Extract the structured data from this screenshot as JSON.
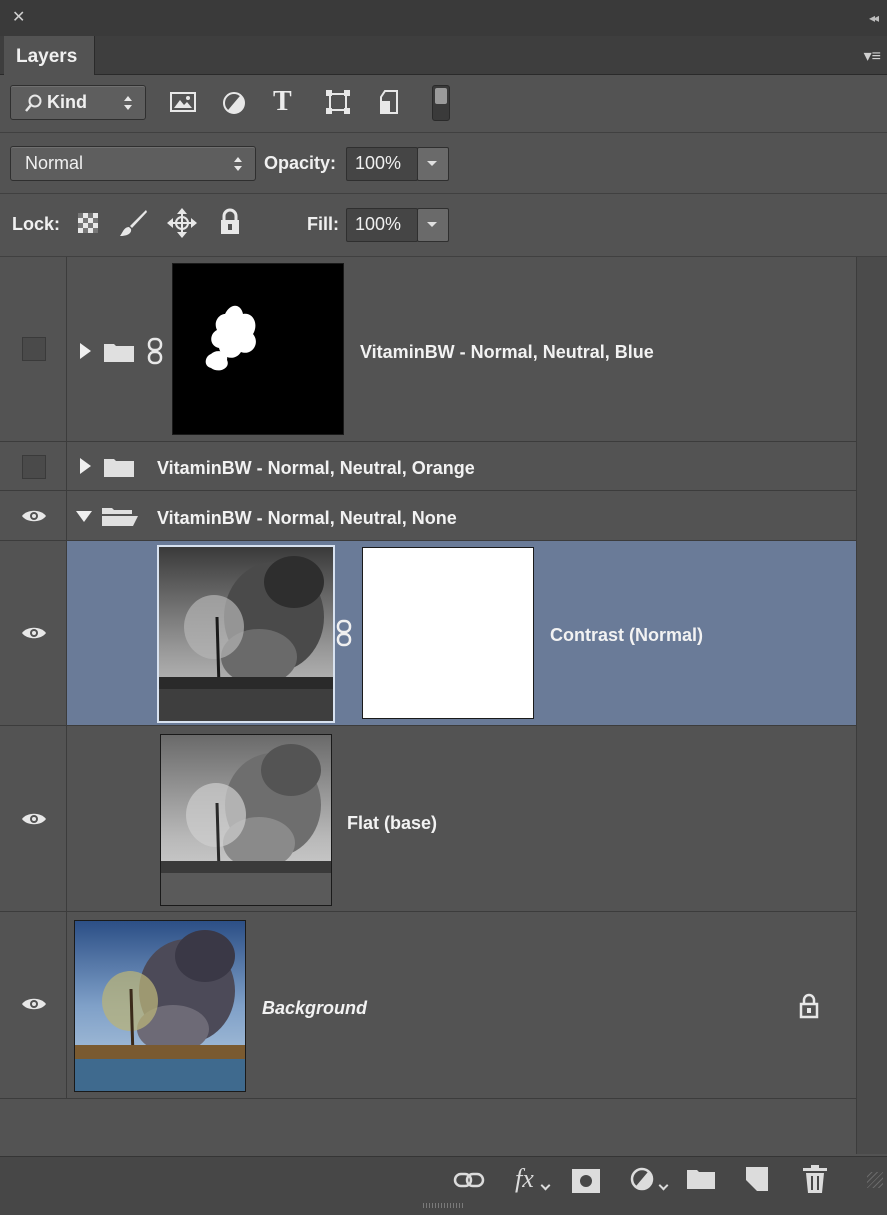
{
  "panel": {
    "close_glyph": "✕",
    "collapse_glyph": "◂◂",
    "tab_label": "Layers",
    "menu_glyph": "▾≡"
  },
  "filter": {
    "kind_label": "Kind",
    "icons": [
      "image-filter-icon",
      "adjustment-filter-icon",
      "type-filter-icon",
      "shape-filter-icon",
      "smart-object-filter-icon",
      "filter-toggle-icon"
    ],
    "type_glyph": "T"
  },
  "blend": {
    "mode": "Normal",
    "opacity_label": "Opacity:",
    "opacity_value": "100%"
  },
  "lock": {
    "label": "Lock:",
    "fill_label": "Fill:",
    "fill_value": "100%"
  },
  "layers": [
    {
      "name": "VitaminBW - Normal, Neutral, Blue",
      "visible": false,
      "type": "group-with-mask",
      "expanded": false
    },
    {
      "name": "VitaminBW - Normal, Neutral, Orange",
      "visible": false,
      "type": "group",
      "expanded": false
    },
    {
      "name": "VitaminBW - Normal, Neutral, None",
      "visible": true,
      "type": "group",
      "expanded": true
    },
    {
      "name": "Contrast (Normal)",
      "visible": true,
      "type": "layer-with-mask",
      "selected": true
    },
    {
      "name": "Flat (base)",
      "visible": true,
      "type": "layer"
    },
    {
      "name": "Background",
      "visible": true,
      "type": "background",
      "locked": true
    }
  ],
  "colors": {
    "panel_bg": "#535353",
    "selected_row": "#6a7b98",
    "titlebar": "#3a3a3a"
  },
  "bottom_toolbar": [
    "link-layers-icon",
    "fx-icon",
    "add-mask-icon",
    "adjustment-layer-icon",
    "new-group-icon",
    "new-layer-icon",
    "trash-icon"
  ],
  "fx_label": "fx"
}
